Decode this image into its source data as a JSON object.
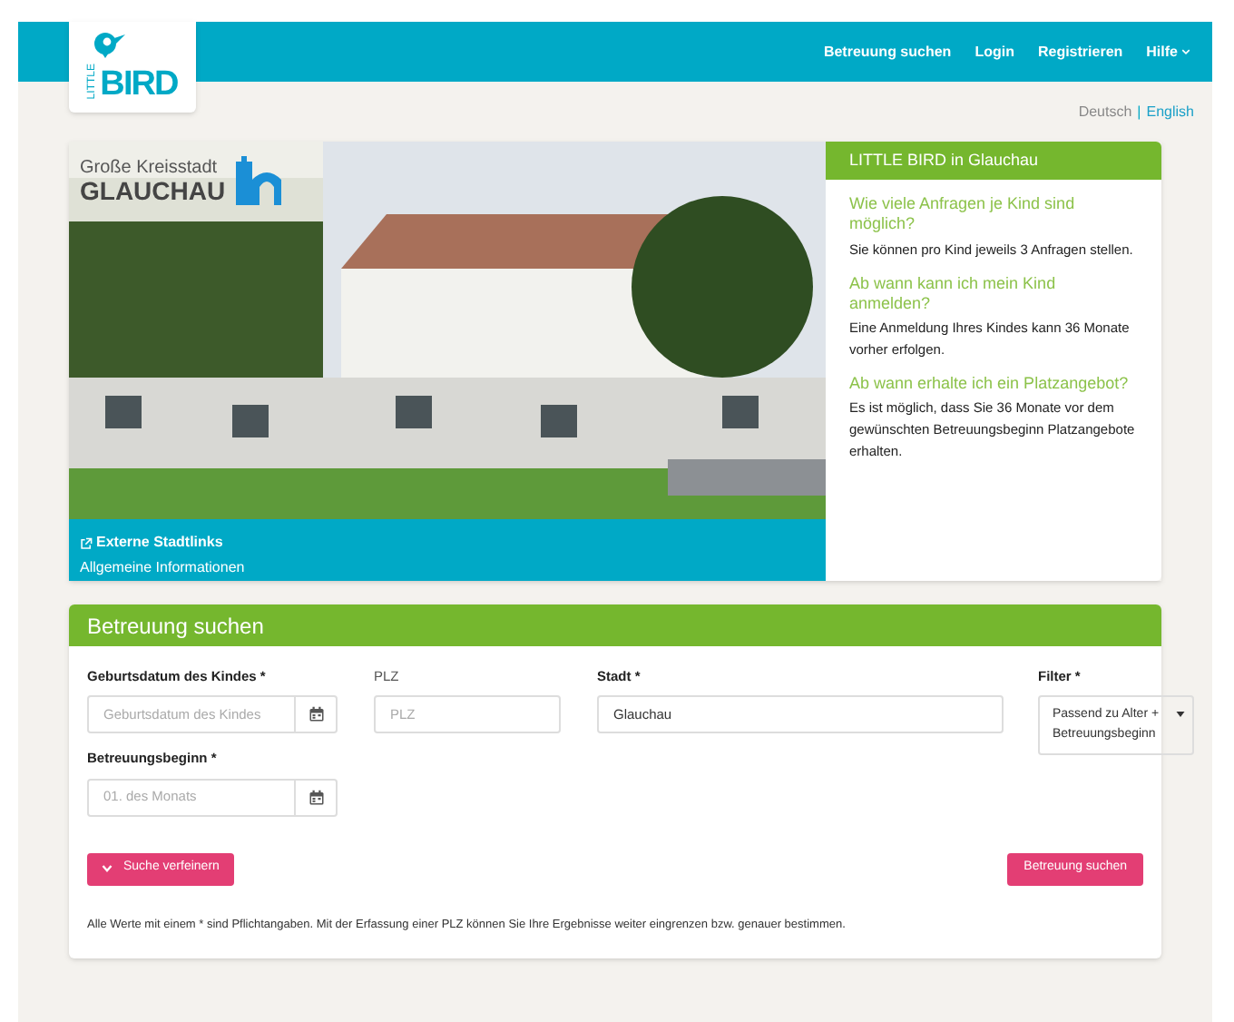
{
  "logo": {
    "small": "LITTLE",
    "big": "BIRD"
  },
  "nav": [
    {
      "label": "Betreuung suchen",
      "dropdown": false
    },
    {
      "label": "Login",
      "dropdown": false
    },
    {
      "label": "Registrieren",
      "dropdown": false
    },
    {
      "label": "Hilfe",
      "dropdown": true
    }
  ],
  "language_separator": "|",
  "languages": [
    {
      "label": "Deutsch",
      "selected": true
    },
    {
      "label": "English",
      "selected": false
    }
  ],
  "hero": {
    "city_badge": {
      "line_1": "Große Kreisstadt",
      "line_2": "GLAUCHAU"
    },
    "links": [
      {
        "label": "Externe Stadtlinks",
        "icon": true
      },
      {
        "label": "Allgemeine Informationen",
        "icon": false
      }
    ]
  },
  "info_panel": {
    "title": "LITTLE BIRD in Glauchau",
    "faq": [
      {
        "question": "Wie viele Anfragen je Kind sind möglich?",
        "answer": "Sie können pro Kind jeweils 3 Anfragen stellen."
      },
      {
        "question": "Ab wann kann ich mein Kind anmelden?",
        "answer": "Eine Anmeldung Ihres Kindes kann 36 Monate vorher erfolgen."
      },
      {
        "question": "Ab wann erhalte ich ein Platzangebot?",
        "answer": "Es ist möglich, dass Sie 36 Monate vor dem gewünschten Betreuungsbeginn Platzangebote erhalten."
      }
    ]
  },
  "search": {
    "title": "Betreuung suchen",
    "birth_date": {
      "label": "Geburtsdatum des Kindes *",
      "placeholder": "Geburtsdatum des Kindes"
    },
    "zip": {
      "label": "PLZ",
      "placeholder": "PLZ"
    },
    "city": {
      "label": "Stadt *",
      "value": "Glauchau"
    },
    "filter": {
      "label": "Filter *",
      "value": "Passend zu Alter + Betreuungsbeginn"
    },
    "start": {
      "label": "Betreuungsbeginn *",
      "placeholder": "01. des Monats"
    },
    "refine_button": "Suche verfeinern",
    "search_button": "Betreuung suchen",
    "note": "Alle Werte mit einem * sind Pflichtangaben. Mit der Erfassung einer PLZ können Sie Ihre Ergebnisse weiter eingrenzen bzw. genauer bestimmen."
  }
}
